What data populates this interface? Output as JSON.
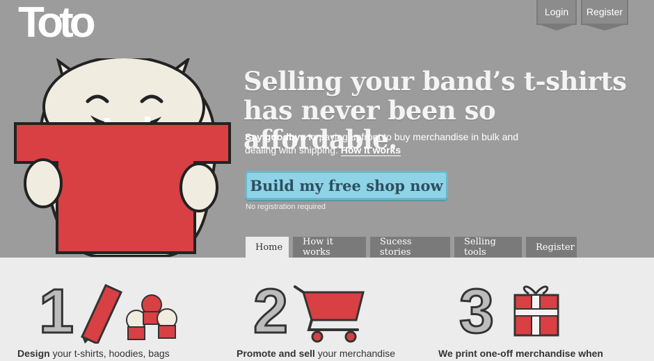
{
  "brand": {
    "logo_text": "Toto"
  },
  "auth": {
    "login": "Login",
    "register": "Register"
  },
  "hero": {
    "headline_line1": "Selling your band’s t-shirts",
    "headline_line2": "has never been so affordable.",
    "sub_bold": "Say goodbye",
    "sub_rest": "to paying upfront to buy merchandise in bulk and dealing with shipping.",
    "how_link": "How it works",
    "cta": "Build my free shop now",
    "cta_note": "No registration required"
  },
  "tabs": [
    "Home",
    "How it works",
    "Sucess stories",
    "Selling tools",
    "Register"
  ],
  "steps": [
    {
      "number": "1",
      "bold": "Design",
      "rest": "your t-shirts, hoodies, bags"
    },
    {
      "number": "2",
      "bold": "Promote and sell",
      "rest": "your merchandise"
    },
    {
      "number": "3",
      "bold": "We print one-off merchandise when",
      "rest": ""
    }
  ],
  "colors": {
    "hero_bg": "#9b9b9b",
    "cta_bg": "#8fd3e6",
    "accent_red": "#d84043"
  }
}
